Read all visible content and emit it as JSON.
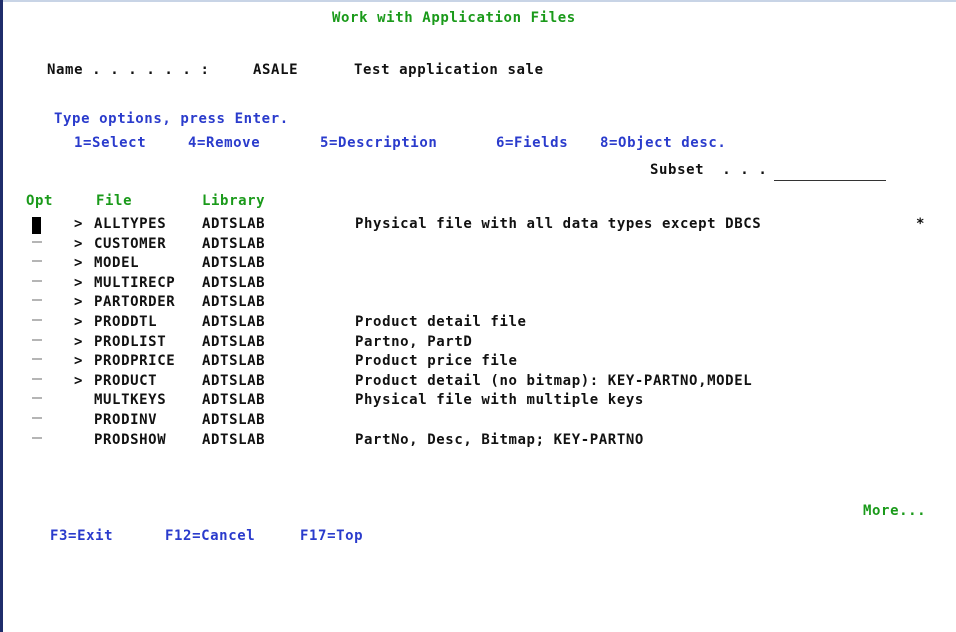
{
  "header": {
    "title": "Work with Application Files"
  },
  "name_row": {
    "label": "Name . . . . . . :",
    "value": "ASALE",
    "description": "Test application sale"
  },
  "instructions": {
    "line": "Type options, press Enter.",
    "options": [
      "1=Select",
      "4=Remove",
      "5=Description",
      "6=Fields",
      "8=Object desc."
    ]
  },
  "subset": {
    "label": "Subset  . . .",
    "value": ""
  },
  "columns": {
    "opt": "Opt",
    "file": "File",
    "library": "Library"
  },
  "rows": [
    {
      "opt": "",
      "marker": ">",
      "file": "ALLTYPES",
      "library": "ADTSLAB",
      "description": "Physical file with all data types except DBCS",
      "flag": "*"
    },
    {
      "opt": "",
      "marker": ">",
      "file": "CUSTOMER",
      "library": "ADTSLAB",
      "description": "",
      "flag": ""
    },
    {
      "opt": "",
      "marker": ">",
      "file": "MODEL",
      "library": "ADTSLAB",
      "description": "",
      "flag": ""
    },
    {
      "opt": "",
      "marker": ">",
      "file": "MULTIRECP",
      "library": "ADTSLAB",
      "description": "",
      "flag": ""
    },
    {
      "opt": "",
      "marker": ">",
      "file": "PARTORDER",
      "library": "ADTSLAB",
      "description": "",
      "flag": ""
    },
    {
      "opt": "",
      "marker": ">",
      "file": "PRODDTL",
      "library": "ADTSLAB",
      "description": "Product detail file",
      "flag": ""
    },
    {
      "opt": "",
      "marker": ">",
      "file": "PRODLIST",
      "library": "ADTSLAB",
      "description": "Partno, PartD",
      "flag": ""
    },
    {
      "opt": "",
      "marker": ">",
      "file": "PRODPRICE",
      "library": "ADTSLAB",
      "description": "Product price file",
      "flag": ""
    },
    {
      "opt": "",
      "marker": ">",
      "file": "PRODUCT",
      "library": "ADTSLAB",
      "description": "Product detail (no bitmap): KEY-PARTNO,MODEL",
      "flag": ""
    },
    {
      "opt": "",
      "marker": "",
      "file": "MULTKEYS",
      "library": "ADTSLAB",
      "description": "Physical file with multiple keys",
      "flag": ""
    },
    {
      "opt": "",
      "marker": "",
      "file": "PRODINV",
      "library": "ADTSLAB",
      "description": "",
      "flag": ""
    },
    {
      "opt": "",
      "marker": "",
      "file": "PRODSHOW",
      "library": "ADTSLAB",
      "description": "PartNo, Desc, Bitmap; KEY-PARTNO",
      "flag": ""
    }
  ],
  "more": "More...",
  "function_keys": [
    "F3=Exit",
    "F12=Cancel",
    "F17=Top"
  ]
}
